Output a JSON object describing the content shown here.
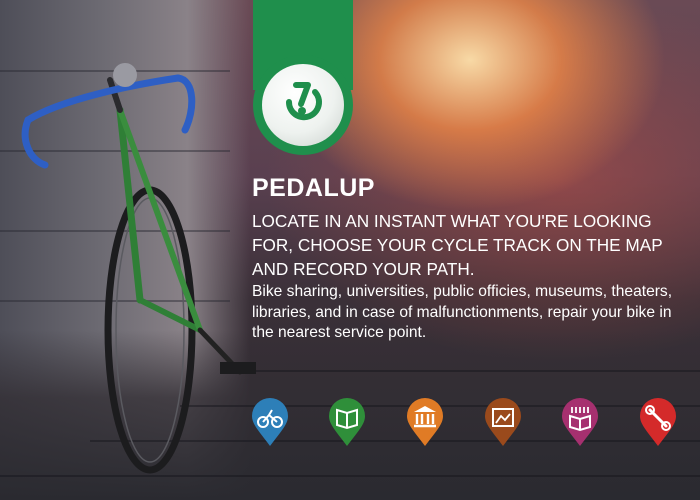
{
  "app": {
    "title": "PEDALUP",
    "tagline": "LOCATE IN AN INSTANT WHAT YOU'RE LOOKING FOR, CHOOSE YOUR CYCLE TRACK ON THE MAP AND RECORD YOUR PATH.",
    "description": "Bike sharing, universities, public officies, museums, theaters, libraries, and in case of malfunctionments, repair your bike in the nearest service point.",
    "brand_color": "#1f8f4c"
  },
  "categories": [
    {
      "icon": "bike-sharing-icon",
      "color": "#2d7fb8"
    },
    {
      "icon": "university-book-icon",
      "color": "#2f8f3a"
    },
    {
      "icon": "public-office-building-icon",
      "color": "#e07b25"
    },
    {
      "icon": "museum-frame-icon",
      "color": "#9a4a1c"
    },
    {
      "icon": "library-books-icon",
      "color": "#a6306f"
    },
    {
      "icon": "repair-wrench-icon",
      "color": "#d42a2a"
    }
  ]
}
